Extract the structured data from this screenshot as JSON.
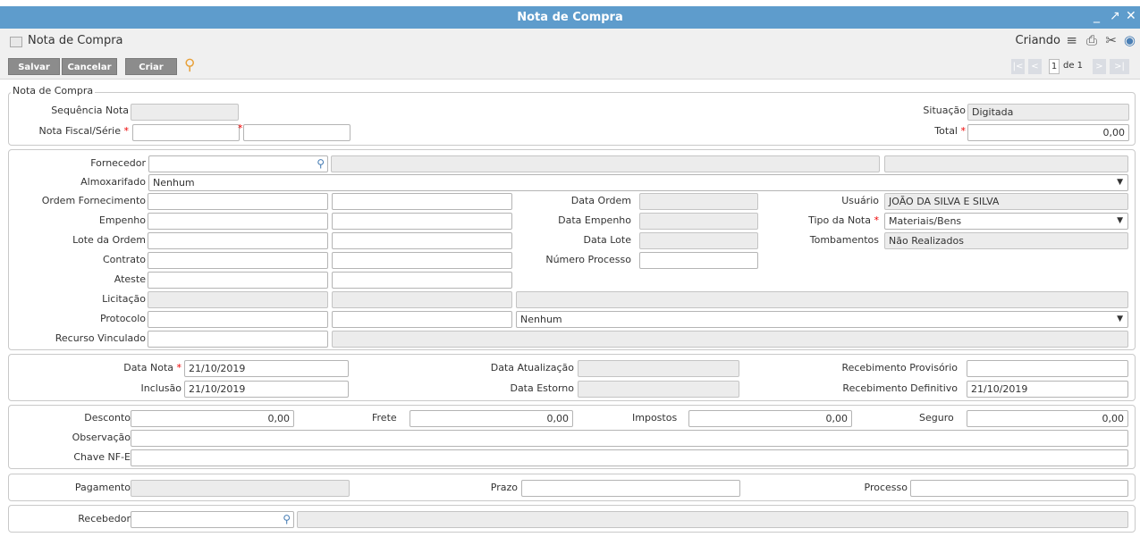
{
  "window": {
    "title": "Nota de Compra",
    "controls": [
      "_",
      "↗",
      "✕"
    ]
  },
  "header": {
    "title": "Nota de Compra",
    "mode": "Criando"
  },
  "toolbar": {
    "save": "Salvar",
    "cancel": "Cancelar",
    "create": "Criar",
    "first": "|<",
    "prev": "<",
    "page": "1",
    "of": "de 1",
    "next": ">",
    "last": ">|"
  },
  "nota": {
    "legend": "Nota de Compra",
    "sequencia_label": "Sequência Nota",
    "sequencia_value": "",
    "nf_label": "Nota Fiscal/Série",
    "nf_value": "",
    "serie_value": "",
    "situacao_label": "Situação",
    "situacao_value": "Digitada",
    "total_label": "Total",
    "total_value": "0,00"
  },
  "forn": {
    "fornecedor_label": "Fornecedor",
    "almox_label": "Almoxarifado",
    "almox_value": "Nenhum",
    "ordem_label": "Ordem Fornecimento",
    "empenho_label": "Empenho",
    "lote_label": "Lote da Ordem",
    "contrato_label": "Contrato",
    "ateste_label": "Ateste",
    "licitacao_label": "Licitação",
    "protocolo_label": "Protocolo",
    "protocolo_select": "Nenhum",
    "recurso_label": "Recurso Vinculado",
    "data_ordem_label": "Data Ordem",
    "data_empenho_label": "Data Empenho",
    "data_lote_label": "Data Lote",
    "numero_processo_label": "Número Processo",
    "usuario_label": "Usuário",
    "usuario_value": "JOÃO DA SILVA E SILVA",
    "tipo_label": "Tipo da Nota",
    "tipo_value": "Materiais/Bens",
    "tomb_label": "Tombamentos",
    "tomb_value": "Não Realizados"
  },
  "datas": {
    "data_nota_label": "Data Nota",
    "data_nota_value": "21/10/2019",
    "inclusao_label": "Inclusão",
    "inclusao_value": "21/10/2019",
    "atualizacao_label": "Data Atualização",
    "estorno_label": "Data Estorno",
    "receb_prov_label": "Recebimento Provisório",
    "receb_def_label": "Recebimento Definitivo",
    "receb_def_value": "21/10/2019"
  },
  "valores": {
    "desconto_label": "Desconto",
    "desconto_value": "0,00",
    "frete_label": "Frete",
    "frete_value": "0,00",
    "impostos_label": "Impostos",
    "impostos_value": "0,00",
    "seguro_label": "Seguro",
    "seguro_value": "0,00",
    "obs_label": "Observação",
    "chave_label": "Chave NF-E"
  },
  "pag": {
    "pagamento_label": "Pagamento",
    "prazo_label": "Prazo",
    "processo_label": "Processo"
  },
  "receb": {
    "recebedor_label": "Recebedor"
  },
  "icons": {
    "lookup": "magnifier-icon",
    "menu": "hamburger-icon",
    "print": "printer-icon",
    "tools": "tools-icon",
    "help": "help-icon"
  }
}
